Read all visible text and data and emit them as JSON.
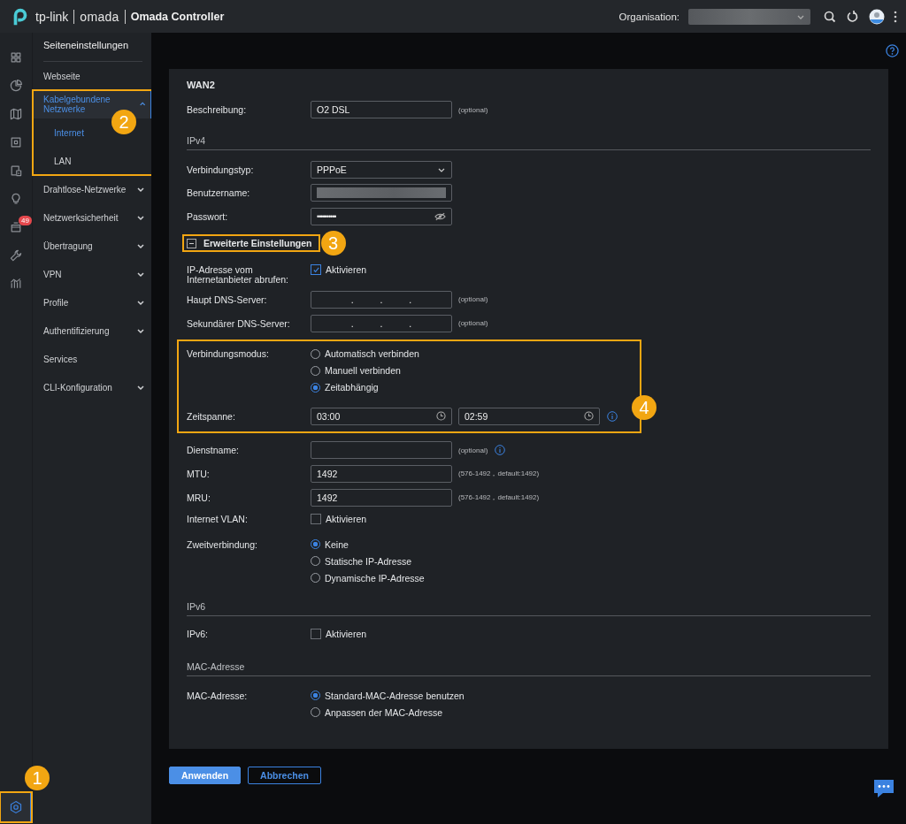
{
  "header": {
    "brand": "tp-link",
    "product": "omada",
    "title": "Omada Controller",
    "org_label": "Organisation:"
  },
  "rail": {
    "items": [
      {
        "kind": "dashboard",
        "selected": false
      },
      {
        "kind": "statistics",
        "selected": false
      },
      {
        "kind": "map",
        "selected": false
      },
      {
        "kind": "devices",
        "selected": false
      },
      {
        "kind": "clients",
        "selected": false
      },
      {
        "kind": "insight",
        "selected": false
      },
      {
        "kind": "log",
        "selected": false,
        "badge": "49"
      },
      {
        "kind": "tools",
        "selected": false
      },
      {
        "kind": "reports",
        "selected": false
      }
    ],
    "settings": {
      "selected": true,
      "callout": "1"
    }
  },
  "sidebar": {
    "title": "Seiteneinstellungen",
    "items": [
      {
        "label": "Webseite",
        "selected": false
      },
      {
        "label": "Kabelgebundene Netzwerke",
        "selected": true,
        "expanded": true,
        "callout": "2",
        "children": [
          {
            "label": "Internet",
            "selected": true
          },
          {
            "label": "LAN",
            "selected": false
          }
        ]
      },
      {
        "label": "Drahtlose-Netzwerke",
        "selected": false,
        "expanded": false
      },
      {
        "label": "Netzwerksicherheit",
        "selected": false,
        "expanded": false
      },
      {
        "label": "Übertragung",
        "selected": false,
        "expanded": false
      },
      {
        "label": "VPN",
        "selected": false,
        "expanded": false
      },
      {
        "label": "Profile",
        "selected": false,
        "expanded": false
      },
      {
        "label": "Authentifizierung",
        "selected": false,
        "expanded": false
      },
      {
        "label": "Services",
        "selected": false
      },
      {
        "label": "CLI-Konfiguration",
        "selected": false,
        "expanded": false
      }
    ]
  },
  "form": {
    "title": "WAN2",
    "rows": [
      {
        "kind": "text",
        "label": "Beschreibung:",
        "value": "O2 DSL",
        "hint": "(optional)"
      },
      {
        "kind": "section",
        "label": "IPv4"
      },
      {
        "kind": "select",
        "label": "Verbindungstyp:",
        "value": "PPPoE"
      },
      {
        "kind": "blurred",
        "label": "Benutzername:"
      },
      {
        "kind": "password",
        "label": "Passwort:",
        "value": "••••••••••"
      },
      {
        "kind": "expander",
        "label": "Erweiterte Einstellungen",
        "expanded": true,
        "callout": "3"
      },
      {
        "kind": "checkbox",
        "label": "IP-Adresse vom Internetanbieter abrufen:",
        "option": "Aktivieren",
        "checked": true
      },
      {
        "kind": "ip",
        "label": "Haupt DNS-Server:",
        "separators": [
          ".",
          ".",
          "."
        ],
        "hint": "(optional)"
      },
      {
        "kind": "ip",
        "label": "Sekundärer DNS-Server:",
        "separators": [
          ".",
          ".",
          "."
        ],
        "hint": "(optional)"
      },
      {
        "kind": "group",
        "callout": "4",
        "rows": [
          {
            "kind": "radio",
            "label": "Verbindungsmodus:",
            "options": [
              {
                "label": "Automatisch verbinden",
                "selected": false
              },
              {
                "label": "Manuell verbinden",
                "selected": false
              },
              {
                "label": "Zeitabhängig",
                "selected": true
              }
            ]
          },
          {
            "kind": "timerange",
            "label": "Zeitspanne:",
            "from": "03:00",
            "to": "02:59",
            "info": true
          }
        ]
      },
      {
        "kind": "text",
        "label": "Dienstname:",
        "hint": "(optional)",
        "info": true
      },
      {
        "kind": "text",
        "label": "MTU:",
        "value": "1492",
        "hint": "(576-1492，default:1492)"
      },
      {
        "kind": "text",
        "label": "MRU:",
        "value": "1492",
        "hint": "(576-1492，default:1492)"
      },
      {
        "kind": "checkbox",
        "label": "Internet VLAN:",
        "option": "Aktivieren",
        "checked": false
      },
      {
        "kind": "radio",
        "label": "Zweitverbindung:",
        "options": [
          {
            "label": "Keine",
            "selected": true
          },
          {
            "label": "Statische IP-Adresse",
            "selected": false
          },
          {
            "label": "Dynamische IP-Adresse",
            "selected": false
          }
        ]
      },
      {
        "kind": "section",
        "label": "IPv6"
      },
      {
        "kind": "checkbox",
        "label": "IPv6:",
        "option": "Aktivieren",
        "checked": false
      },
      {
        "kind": "section",
        "label": "MAC-Adresse"
      },
      {
        "kind": "radio",
        "label": "MAC-Adresse:",
        "options": [
          {
            "label": "Standard-MAC-Adresse benutzen",
            "selected": true
          },
          {
            "label": "Anpassen der MAC-Adresse",
            "selected": false
          }
        ]
      }
    ]
  },
  "buttons": [
    {
      "label": "Anwenden",
      "kind": "primary"
    },
    {
      "label": "Abbrechen",
      "kind": "secondary"
    }
  ]
}
